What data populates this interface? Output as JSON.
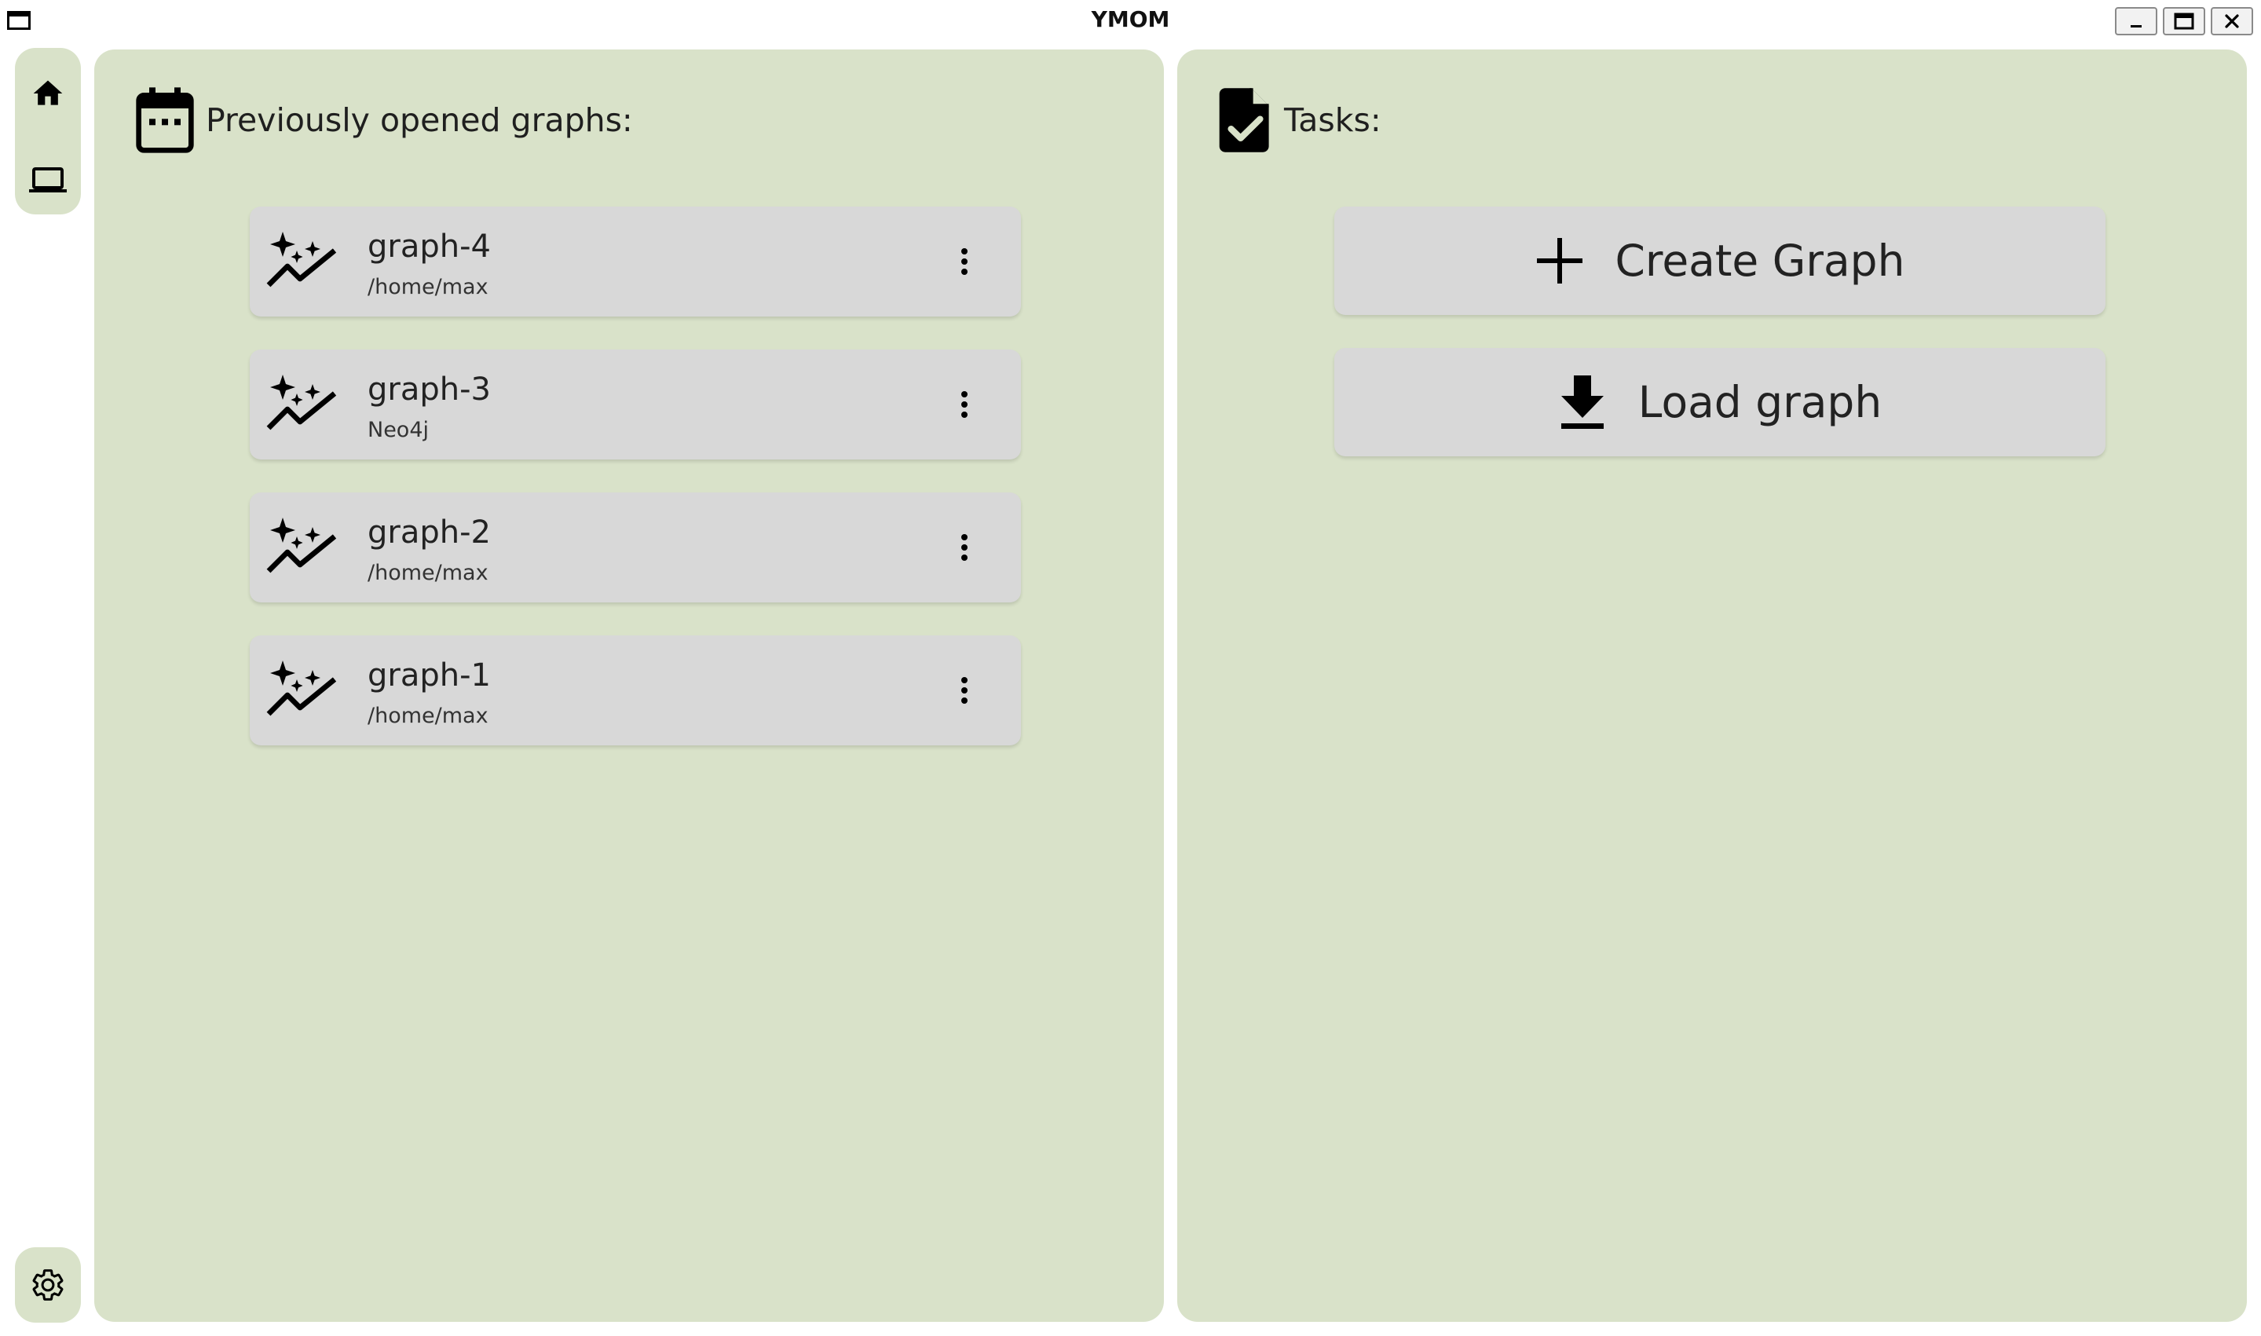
{
  "window": {
    "title": "YMOM",
    "controls": {
      "minimize": "minimize-icon",
      "maximize": "maximize-icon",
      "close": "close-icon"
    }
  },
  "nav_rail": {
    "items": [
      {
        "icon": "home-icon"
      },
      {
        "icon": "laptop-icon"
      }
    ],
    "settings_icon": "gear-icon"
  },
  "recent": {
    "icon": "calendar-icon",
    "title": "Previously opened graphs:",
    "graphs": [
      {
        "name": "graph-4",
        "location": "/home/max",
        "icon": "auto-graph-icon"
      },
      {
        "name": "graph-3",
        "location": "Neo4j",
        "icon": "auto-graph-icon"
      },
      {
        "name": "graph-2",
        "location": "/home/max",
        "icon": "auto-graph-icon"
      },
      {
        "name": "graph-1",
        "location": "/home/max",
        "icon": "auto-graph-icon"
      }
    ]
  },
  "tasks": {
    "icon": "task-file-icon",
    "title": "Tasks:",
    "create_label": "Create Graph",
    "load_label": "Load graph"
  },
  "colors": {
    "panel_background": "#d9e2c9",
    "card_background": "#d8d8d8",
    "text": "#222222"
  }
}
